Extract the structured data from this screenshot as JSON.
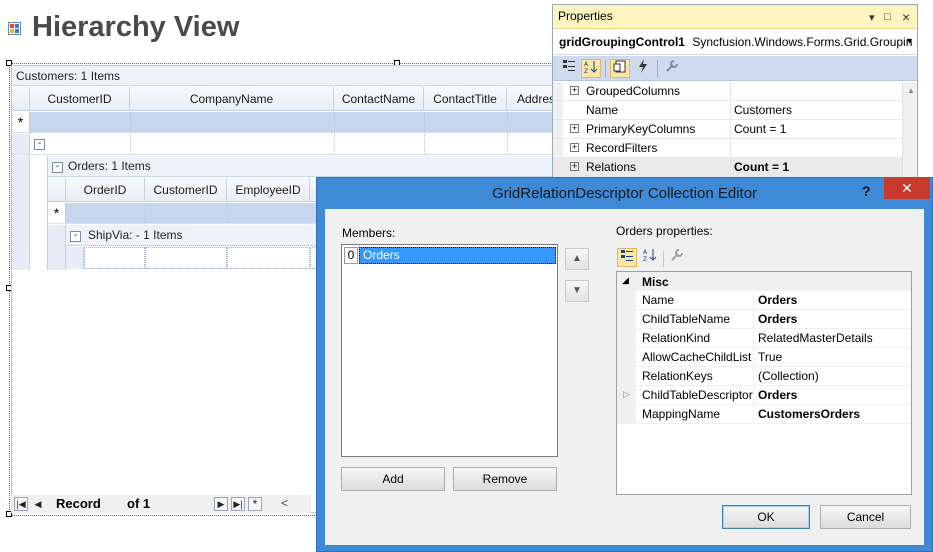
{
  "form": {
    "title": "Hierarchy View"
  },
  "grid": {
    "customers_caption": "Customers: 1 Items",
    "customers_columns": [
      "CustomerID",
      "CompanyName",
      "ContactName",
      "ContactTitle",
      "Addres"
    ],
    "add_row_marker": "*",
    "expander_symbol": "-",
    "orders_caption": "Orders: 1 Items",
    "orders_columns": [
      "OrderID",
      "CustomerID",
      "EmployeeID"
    ],
    "shipvia_caption": "ShipVia:  - 1 Items"
  },
  "navbar": {
    "record_label": "Record",
    "of_label": "of 1",
    "first": "|◀",
    "prev": "◀",
    "next": "▶",
    "last": "▶|",
    "new": "*",
    "scroll_left": "<"
  },
  "properties": {
    "title": "Properties",
    "pin_glyph": "▾",
    "maximize_glyph": "□",
    "close_glyph": "×",
    "object_name": "gridGroupingControl1",
    "object_type": "Syncfusion.Windows.Forms.Grid.Groupin",
    "object_dropdown": "▾",
    "rows": [
      {
        "expandable": true,
        "name": "GroupedColumns",
        "value": "",
        "bold": false
      },
      {
        "expandable": false,
        "name": "Name",
        "value": "Customers",
        "bold": false
      },
      {
        "expandable": true,
        "name": "PrimaryKeyColumns",
        "value": "Count = 1",
        "bold": false
      },
      {
        "expandable": true,
        "name": "RecordFilters",
        "value": "",
        "bold": false
      },
      {
        "expandable": true,
        "name": "Relations",
        "value": "Count = 1",
        "bold": true
      }
    ],
    "scroll_up": "▲"
  },
  "dialog": {
    "title": "GridRelationDescriptor Collection Editor",
    "help": "?",
    "close": "✕",
    "members_label": "Members:",
    "member_index": "0",
    "member_name": "Orders",
    "move_up": "▲",
    "move_down": "▼",
    "add_button": "Add",
    "remove_button": "Remove",
    "props_label": "Orders properties:",
    "category": "Misc",
    "category_toggle": "◢",
    "expand_glyph": "▷",
    "props": [
      {
        "name": "Name",
        "value": "Orders",
        "bold": true,
        "expandable": false
      },
      {
        "name": "ChildTableName",
        "value": "Orders",
        "bold": true,
        "expandable": false
      },
      {
        "name": "RelationKind",
        "value": "RelatedMasterDetails",
        "bold": false,
        "expandable": false
      },
      {
        "name": "AllowCacheChildList",
        "value": "True",
        "bold": false,
        "expandable": false
      },
      {
        "name": "RelationKeys",
        "value": "(Collection)",
        "bold": false,
        "expandable": false
      },
      {
        "name": "ChildTableDescriptor",
        "value": "Orders",
        "bold": true,
        "expandable": true
      },
      {
        "name": "MappingName",
        "value": "CustomersOrders",
        "bold": true,
        "expandable": false
      }
    ],
    "ok_button": "OK",
    "cancel_button": "Cancel"
  }
}
